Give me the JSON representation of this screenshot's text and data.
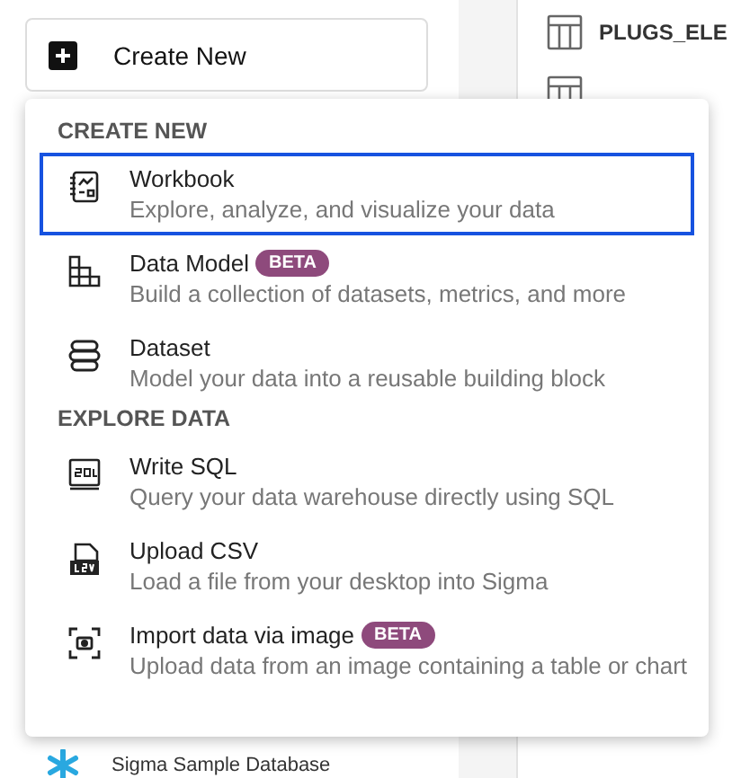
{
  "create_button": {
    "label": "Create New"
  },
  "tables": [
    {
      "kind": "table",
      "name": "PLUGS_ELE"
    },
    {
      "kind": "table"
    }
  ],
  "database": {
    "name": "Sigma Sample Database"
  },
  "menu": {
    "sections": [
      {
        "title": "CREATE NEW",
        "items": [
          {
            "kind": "workbook",
            "title": "Workbook",
            "description": "Explore, analyze, and visualize your data",
            "selected": true
          },
          {
            "kind": "datamodel",
            "title": "Data Model",
            "badge": "BETA",
            "description": "Build a collection of datasets, metrics, and more",
            "selected": false
          },
          {
            "kind": "dataset",
            "title": "Dataset",
            "description": "Model your data into a reusable building block",
            "selected": false
          }
        ]
      },
      {
        "title": "EXPLORE DATA",
        "items": [
          {
            "kind": "sql",
            "title": "Write SQL",
            "description": "Query your data warehouse directly using SQL",
            "selected": false
          },
          {
            "kind": "csv",
            "title": "Upload CSV",
            "description": "Load a file from your desktop into Sigma",
            "selected": false
          },
          {
            "kind": "image",
            "title": "Import data via image",
            "badge": "BETA",
            "description": "Upload data from an image containing a table or chart",
            "selected": false
          }
        ]
      }
    ]
  }
}
